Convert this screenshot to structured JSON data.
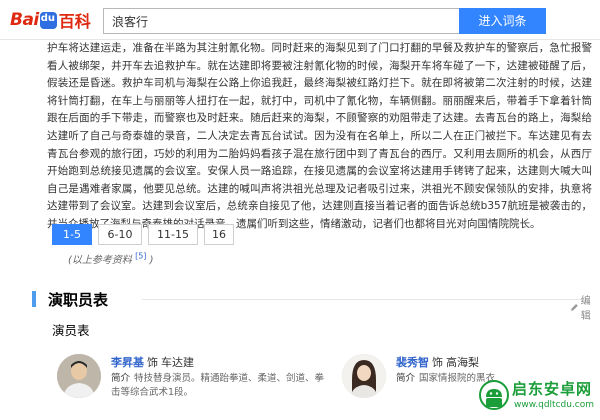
{
  "header": {
    "logo_bai": "Bai",
    "logo_baike": "百科",
    "search_value": "浪客行",
    "enter_button": "进入词条"
  },
  "article": {
    "paragraphs": [
      "护车将达建运走，准备在半路为其注射氰化物。同时赶来的海梨见到了门口打翻的早餐及救护车的警察后，急忙报警看人被绑架，并开车去追救护车。就在达建即将要被注射氰化物的时候，海梨开车将车碰了一下，达建被碰醒了后，假装还是昏迷。救护车司机与海梨在公路上你追我赶，最终海梨被红路灯拦下。就在即将被第二次注射的时候，达建将针筒打翻，在车上与丽丽等人扭打在一起，就打中，司机中了氰化物，车辆侧翻。丽丽醒来后，带着手下拿着针筒跟在后面的手下带走，而警察也及时赶来。随后赶来的海梨，不顾警察的劝阻带走了达建。去青瓦台的路上，海梨给达建听了自己与奇泰雄的录音，二人决定去青瓦台试试。因为没有在名单上，所以二人在正门被拦下。车达建见有去青瓦台参观的旅行团，巧妙的利用为二胎妈妈看孩子混在旅行团中到了青瓦台的西厅。又利用去厕所的机会，从西厅开始跑到总统接见遗属的会议室。安保人员一路追踪，在接见遗属的会议室将达建用手铐铐了起来，达建则大喊大叫自己是遇难者家属，他要见总统。达建的喊叫声将洪祖光总理及记者吸引过来，洪祖光不顾安保领队的安排，执意将达建带到了会议室。达建到会议室后，总统亲自接见了他，达建则直接当着记者的面告诉总统b357航班是被袭击的，并当众播放了海梨与奇泰雄的对话录音。遗属们听到这些，情绪激动，记者们也都将目光对向国情院院长。"
    ]
  },
  "pager": {
    "pages": [
      {
        "label": "1-5",
        "active": true
      },
      {
        "label": "6-10",
        "active": false
      },
      {
        "label": "11-15",
        "active": false
      },
      {
        "label": "16",
        "active": false
      }
    ],
    "ref_note": "(以上参考资料",
    "ref_sup": "[5]",
    "ref_close": ")"
  },
  "section": {
    "title": "演职员表",
    "edit_label": "编辑",
    "subtitle": "演员表"
  },
  "cast": [
    {
      "actor": "李昇基",
      "role_prefix": "饰",
      "role": "车达建",
      "intro_label": "简介",
      "intro": "特技替身演员。精通跆拳道、柔道、剑道、拳击等综合武术1段。"
    },
    {
      "actor": "裴秀智",
      "role_prefix": "饰",
      "role": "高海梨",
      "intro_label": "简介",
      "intro": "国家情报院的黑衣"
    }
  ],
  "watermark": {
    "title": "启东安卓网",
    "url": "www.qdltcdu.com"
  },
  "colors": {
    "accent": "#3385ff",
    "link": "#3366cc",
    "section_bar": "#4f9cee",
    "brand_red": "#de2910",
    "watermark_green": "#1b9e3a"
  },
  "icons": {
    "edit": "pencil-icon",
    "watermark": "android-logo-icon"
  }
}
